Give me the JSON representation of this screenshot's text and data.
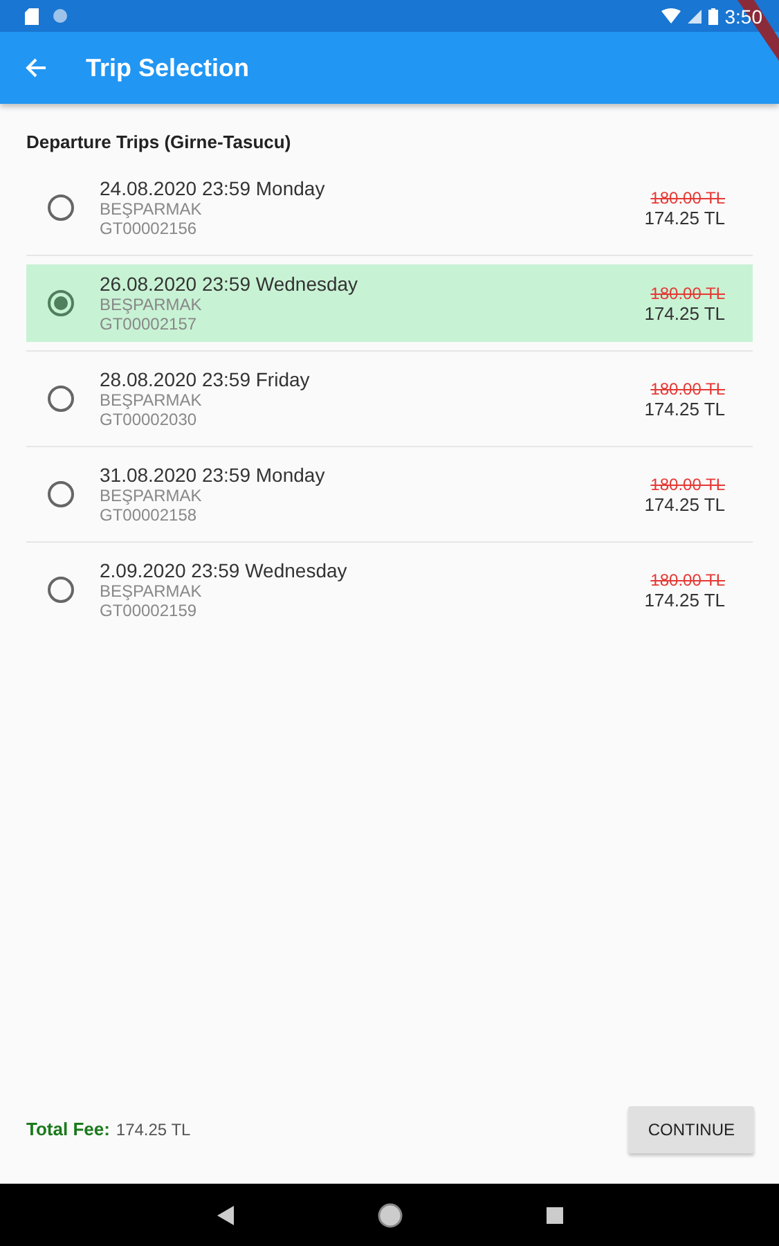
{
  "status_bar": {
    "time": "3:50"
  },
  "app_bar": {
    "title": "Trip Selection"
  },
  "section_title": "Departure Trips (Girne-Tasucu)",
  "trips": [
    {
      "date": "24.08.2020 23:59 Monday",
      "vessel": "BEŞPARMAK",
      "code": "GT00002156",
      "old_price": "180.00 TL",
      "price": "174.25 TL",
      "selected": false
    },
    {
      "date": "26.08.2020 23:59 Wednesday",
      "vessel": "BEŞPARMAK",
      "code": "GT00002157",
      "old_price": "180.00 TL",
      "price": "174.25 TL",
      "selected": true
    },
    {
      "date": "28.08.2020 23:59 Friday",
      "vessel": "BEŞPARMAK",
      "code": "GT00002030",
      "old_price": "180.00 TL",
      "price": "174.25 TL",
      "selected": false
    },
    {
      "date": "31.08.2020 23:59 Monday",
      "vessel": "BEŞPARMAK",
      "code": "GT00002158",
      "old_price": "180.00 TL",
      "price": "174.25 TL",
      "selected": false
    },
    {
      "date": "2.09.2020 23:59 Wednesday",
      "vessel": "BEŞPARMAK",
      "code": "GT00002159",
      "old_price": "180.00 TL",
      "price": "174.25 TL",
      "selected": false
    }
  ],
  "footer": {
    "total_label": "Total Fee:",
    "total_value": "174.25 TL",
    "button": "CONTINUE"
  }
}
